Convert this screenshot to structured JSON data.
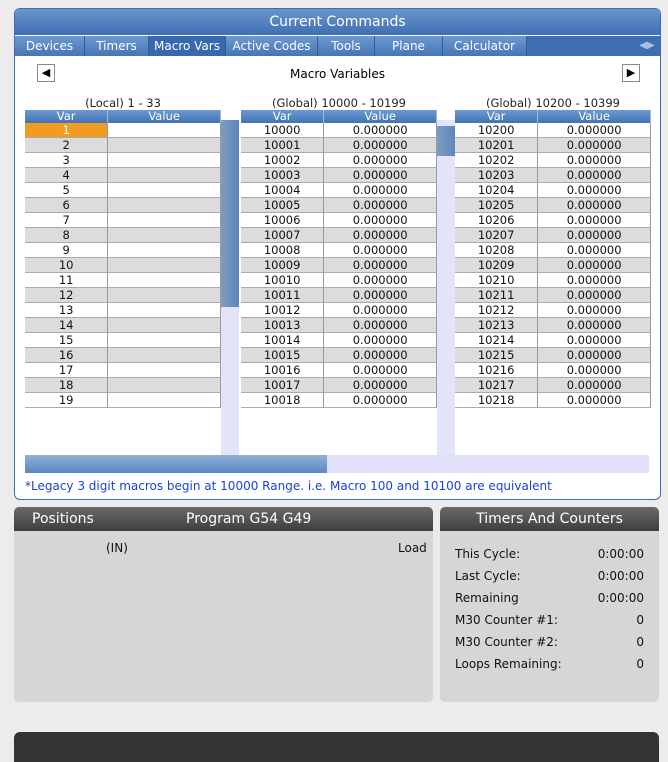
{
  "window": {
    "title": "Current Commands"
  },
  "tabs": [
    {
      "label": "Devices",
      "active": false
    },
    {
      "label": "Timers",
      "active": false
    },
    {
      "label": "Macro Vars",
      "active": true
    },
    {
      "label": "Active Codes",
      "active": false
    },
    {
      "label": "Tools",
      "active": false
    },
    {
      "label": "Plane",
      "active": false
    },
    {
      "label": "Calculator",
      "active": false
    }
  ],
  "tab_scroll": {
    "left_icon": "◀",
    "right_icon": "▶"
  },
  "nav": {
    "title": "Macro Variables",
    "prev_icon": "◀",
    "next_icon": "▶"
  },
  "sections": {
    "local": "(Local) 1 - 33",
    "global1": "(Global) 10000 - 10199",
    "global2": "(Global) 10200 - 10399"
  },
  "columns": {
    "var": "Var",
    "value": "Value"
  },
  "local_rows": [
    {
      "var": "1",
      "value": ""
    },
    {
      "var": "2",
      "value": ""
    },
    {
      "var": "3",
      "value": ""
    },
    {
      "var": "4",
      "value": ""
    },
    {
      "var": "5",
      "value": ""
    },
    {
      "var": "6",
      "value": ""
    },
    {
      "var": "7",
      "value": ""
    },
    {
      "var": "8",
      "value": ""
    },
    {
      "var": "9",
      "value": ""
    },
    {
      "var": "10",
      "value": ""
    },
    {
      "var": "11",
      "value": ""
    },
    {
      "var": "12",
      "value": ""
    },
    {
      "var": "13",
      "value": ""
    },
    {
      "var": "14",
      "value": ""
    },
    {
      "var": "15",
      "value": ""
    },
    {
      "var": "16",
      "value": ""
    },
    {
      "var": "17",
      "value": ""
    },
    {
      "var": "18",
      "value": ""
    },
    {
      "var": "19",
      "value": ""
    }
  ],
  "global1_rows": [
    {
      "var": "10000",
      "value": "0.000000"
    },
    {
      "var": "10001",
      "value": "0.000000"
    },
    {
      "var": "10002",
      "value": "0.000000"
    },
    {
      "var": "10003",
      "value": "0.000000"
    },
    {
      "var": "10004",
      "value": "0.000000"
    },
    {
      "var": "10005",
      "value": "0.000000"
    },
    {
      "var": "10006",
      "value": "0.000000"
    },
    {
      "var": "10007",
      "value": "0.000000"
    },
    {
      "var": "10008",
      "value": "0.000000"
    },
    {
      "var": "10009",
      "value": "0.000000"
    },
    {
      "var": "10010",
      "value": "0.000000"
    },
    {
      "var": "10011",
      "value": "0.000000"
    },
    {
      "var": "10012",
      "value": "0.000000"
    },
    {
      "var": "10013",
      "value": "0.000000"
    },
    {
      "var": "10014",
      "value": "0.000000"
    },
    {
      "var": "10015",
      "value": "0.000000"
    },
    {
      "var": "10016",
      "value": "0.000000"
    },
    {
      "var": "10017",
      "value": "0.000000"
    },
    {
      "var": "10018",
      "value": "0.000000"
    }
  ],
  "global2_rows": [
    {
      "var": "10200",
      "value": "0.000000"
    },
    {
      "var": "10201",
      "value": "0.000000"
    },
    {
      "var": "10202",
      "value": "0.000000"
    },
    {
      "var": "10203",
      "value": "0.000000"
    },
    {
      "var": "10204",
      "value": "0.000000"
    },
    {
      "var": "10205",
      "value": "0.000000"
    },
    {
      "var": "10206",
      "value": "0.000000"
    },
    {
      "var": "10207",
      "value": "0.000000"
    },
    {
      "var": "10208",
      "value": "0.000000"
    },
    {
      "var": "10209",
      "value": "0.000000"
    },
    {
      "var": "10210",
      "value": "0.000000"
    },
    {
      "var": "10211",
      "value": "0.000000"
    },
    {
      "var": "10212",
      "value": "0.000000"
    },
    {
      "var": "10213",
      "value": "0.000000"
    },
    {
      "var": "10214",
      "value": "0.000000"
    },
    {
      "var": "10215",
      "value": "0.000000"
    },
    {
      "var": "10216",
      "value": "0.000000"
    },
    {
      "var": "10217",
      "value": "0.000000"
    },
    {
      "var": "10218",
      "value": "0.000000"
    }
  ],
  "note": "*Legacy 3 digit macros begin at 10000 Range.  i.e. Macro 100 and 10100 are equivalent",
  "positions": {
    "title": "Positions",
    "program": "Program G54 G49",
    "units": "(IN)",
    "load": "Load"
  },
  "timers": {
    "title": "Timers And Counters",
    "rows": [
      {
        "label": "This Cycle:",
        "value": "0:00:00"
      },
      {
        "label": "Last Cycle:",
        "value": "0:00:00"
      },
      {
        "label": "Remaining",
        "value": "0:00:00"
      },
      {
        "label": "M30 Counter #1:",
        "value": "0"
      },
      {
        "label": "M30 Counter #2:",
        "value": "0"
      },
      {
        "label": "Loops Remaining:",
        "value": "0"
      }
    ]
  },
  "colors": {
    "accent": "#3e6fb2",
    "selected": "#f29b21",
    "note_text": "#1a44d0"
  }
}
